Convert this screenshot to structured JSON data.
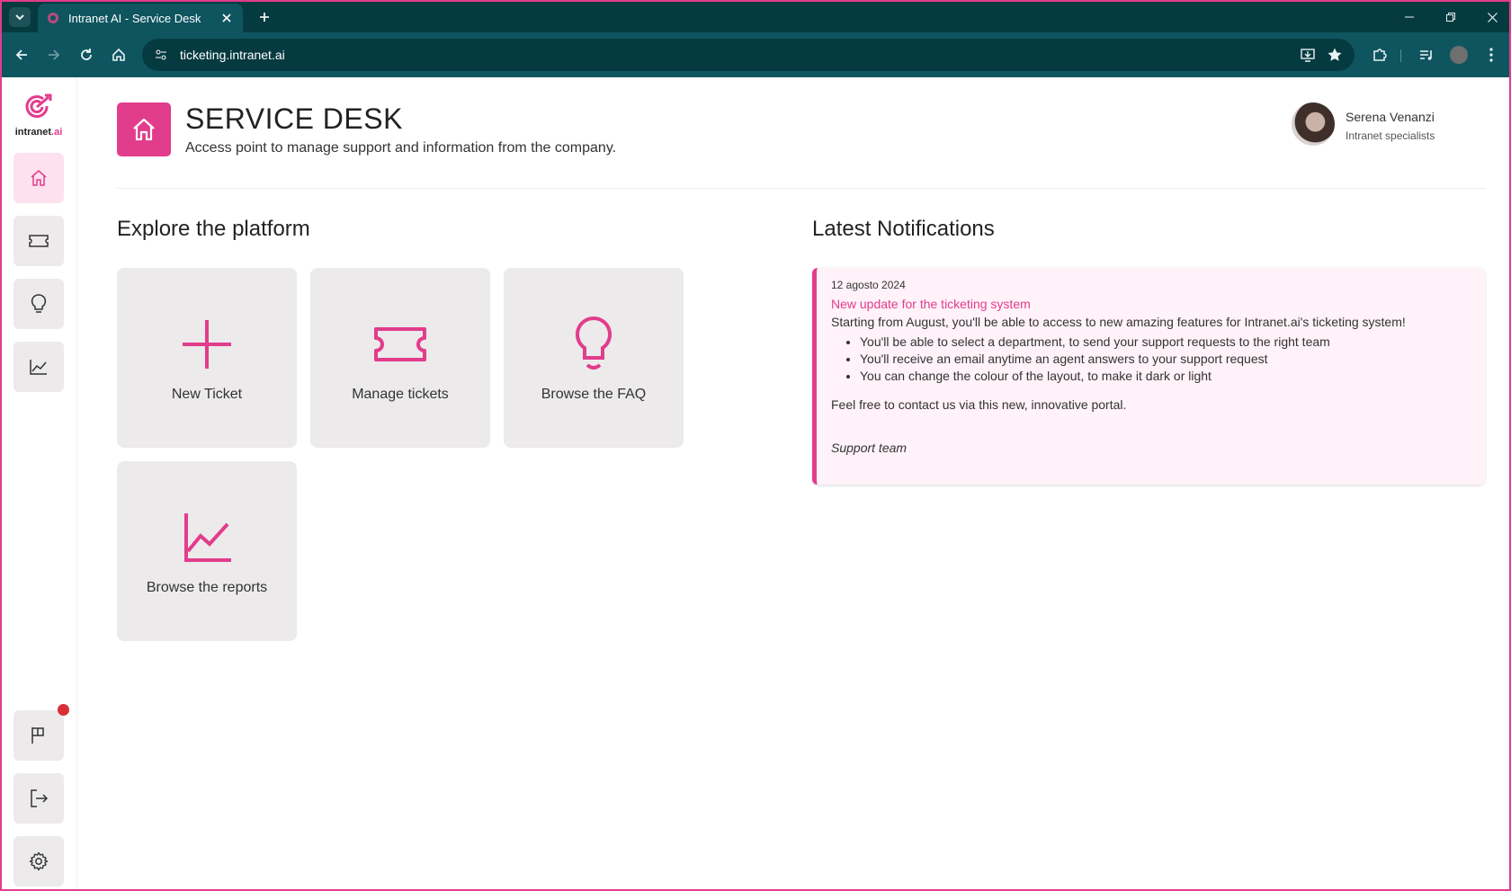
{
  "browser": {
    "tab_title": "Intranet AI - Service Desk",
    "url": "ticketing.intranet.ai"
  },
  "logo": {
    "text_main": "intranet",
    "text_suffix": ".ai"
  },
  "sidebar": {
    "items": [
      {
        "name": "home",
        "icon": "home-icon",
        "active": true
      },
      {
        "name": "tickets",
        "icon": "ticket-icon",
        "active": false
      },
      {
        "name": "faq",
        "icon": "lightbulb-icon",
        "active": false
      },
      {
        "name": "reports",
        "icon": "chart-icon",
        "active": false
      }
    ],
    "bottom_items": [
      {
        "name": "notifications",
        "icon": "flag-icon",
        "has_badge": true
      },
      {
        "name": "logout",
        "icon": "logout-icon"
      },
      {
        "name": "settings",
        "icon": "gear-icon"
      }
    ]
  },
  "header": {
    "title": "SERVICE DESK",
    "subtitle": "Access point to manage support and information from the company."
  },
  "user": {
    "name": "Serena Venanzi",
    "role": "Intranet specialists"
  },
  "explore": {
    "title": "Explore the platform",
    "tiles": [
      {
        "label": "New Ticket",
        "icon": "plus-icon"
      },
      {
        "label": "Manage tickets",
        "icon": "ticket-icon"
      },
      {
        "label": "Browse the FAQ",
        "icon": "lightbulb-icon"
      },
      {
        "label": "Browse the reports",
        "icon": "chart-icon"
      }
    ]
  },
  "notifications": {
    "title": "Latest Notifications",
    "items": [
      {
        "date": "12 agosto 2024",
        "title": "New update for the ticketing system",
        "intro": "Starting from August, you'll be able to access to new amazing features for Intranet.ai's ticketing system!",
        "bullets": [
          "You'll be able to select a department, to send your support requests to the right team",
          "You'll receive an email anytime an agent answers to your support request",
          "You can change the colour of the layout, to make it dark or light"
        ],
        "outro": "Feel free to contact us via this new, innovative portal.",
        "signature": "Support team"
      }
    ]
  },
  "colors": {
    "accent": "#e23c8c",
    "chrome_dark": "#063a41",
    "chrome_bar": "#0f5560",
    "tile_bg": "#eceaea",
    "notification_bg": "#fff2f8",
    "badge": "#d83036"
  }
}
